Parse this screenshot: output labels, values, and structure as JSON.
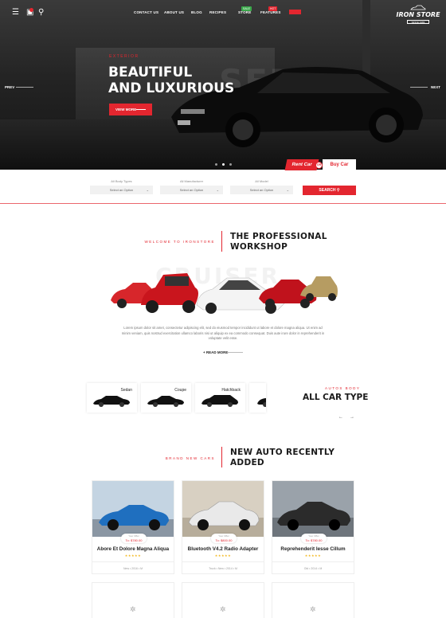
{
  "header": {
    "nav": [
      "CONTACT US",
      "ABOUT US",
      "BLOG",
      "RECIPES",
      "STORE",
      "FEATURES"
    ],
    "nav_badges": {
      "store": "SALE",
      "features": "HOT"
    },
    "logo_name": "IRON STORE",
    "logo_sub": "SINCE 1983"
  },
  "hero": {
    "kicker": "EXTERIOR",
    "title_line1": "BEAUTIFUL",
    "title_line2": "AND LUXURIOUS",
    "bg_word": "SEDAN",
    "button": "VIEW MORE",
    "prev": "PREV",
    "next": "NEXT",
    "tab_rent": "Rent Car",
    "tab_or": "OR",
    "tab_buy": "Buy Car"
  },
  "filter": {
    "labels": [
      "All Body Types",
      "All Manufacturer",
      "All Model"
    ],
    "select_value": "Select an Option",
    "search": "SEARCH"
  },
  "workshop": {
    "kicker": "WELCOME TO IRONSTORE",
    "title_line1": "THE PROFESSIONAL",
    "title_line2": "WORKSHOP",
    "bg_word": "CRUISER",
    "text": "Lorem ipsum dolor sit amet, consectetur adipiscing elit, sed do eiusmod tempor incididunt ut labore et dolore magna aliqua. Ut enim ad minim veniam, quis nostrud exercitation ullamco laboris nisi ut aliquip ex ea commodo consequat. Duis aute irure dolor in reprehenderit in voluptate velit esse.",
    "read_more": "READ MORE"
  },
  "car_types": {
    "kicker": "AUTOS BODY",
    "title": "ALL CAR TYPE",
    "items": [
      "Sedan",
      "Coupe",
      "Hatchback"
    ],
    "prev_arrow": "←",
    "next_arrow": "→"
  },
  "new_cars": {
    "kicker": "BRAND NEW CARS",
    "title_line1": "NEW AUTO RECENTLY",
    "title_line2": "ADDED",
    "products": [
      {
        "title": "Abore Et Dolore Magna Aliqua",
        "tag_label": "Your Offer",
        "price": "To: $780.00",
        "rating": "★★★★★",
        "meta": "New  •  2016  •  M",
        "color": "#1f6fbf"
      },
      {
        "title": "Bluetooth V4.2 Radio Adapter",
        "tag_label": "Your Offer",
        "price": "To: $800.00",
        "rating": "★★★★★",
        "meta": "Truck  •  New  •  2014  •  M",
        "color": "#e9e9e9"
      },
      {
        "title": "Reprehenderit Iesse Cillum",
        "tag_label": "Your Offer",
        "price": "To: $780.00",
        "rating": "★★★★★",
        "meta": "Old  •  2014  •  M",
        "color": "#2b2b2b"
      }
    ]
  }
}
